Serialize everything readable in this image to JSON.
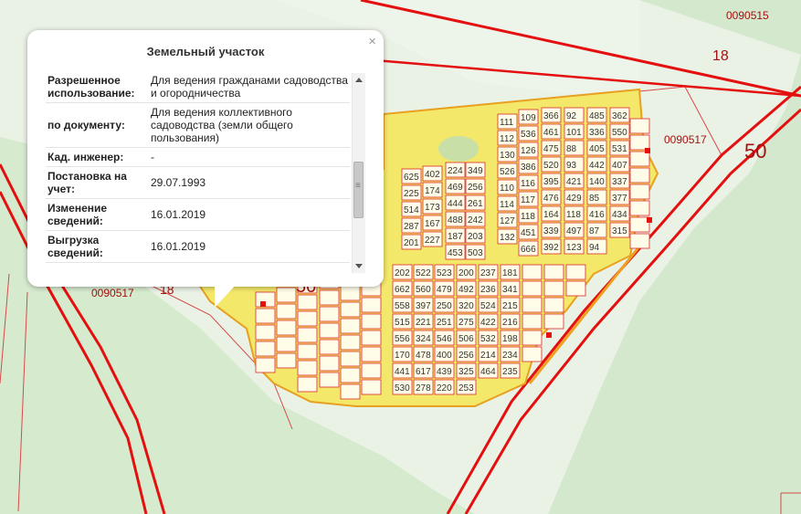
{
  "popup": {
    "title": "Земельный участок",
    "close_symbol": "×",
    "rows": [
      {
        "key": "Разрешенное использование:",
        "value": "Для ведения гражданами садоводства и огородничества"
      },
      {
        "key": "по документу:",
        "value": "Для ведения коллективного садоводства (земли общего пользования)"
      },
      {
        "key": "Кад. инженер:",
        "value": "-"
      },
      {
        "key": "Постановка на учет:",
        "value": "29.07.1993"
      },
      {
        "key": "Изменение сведений:",
        "value": "16.01.2019"
      },
      {
        "key": "Выгрузка сведений:",
        "value": "16.01.2019"
      }
    ]
  },
  "map": {
    "colors": {
      "background": "#e3efde",
      "forest": "#cfe6c7",
      "parcel_fill": "#f4e86a",
      "parcel_border": "#d92a2a",
      "boundary": "#e40f0f",
      "orange_line": "#f0a020"
    },
    "zone_labels": [
      {
        "text": "0090515"
      },
      {
        "text": "18"
      },
      {
        "text": "50"
      },
      {
        "text": "0090517"
      },
      {
        "text": "0090517"
      },
      {
        "text": "18"
      },
      {
        "text": "50"
      }
    ],
    "plot_numbers": [
      "111",
      "112",
      "130",
      "526",
      "110",
      "114",
      "127",
      "132",
      "109",
      "536",
      "126",
      "386",
      "116",
      "117",
      "118",
      "451",
      "666",
      "366",
      "461",
      "475",
      "520",
      "395",
      "476",
      "164",
      "339",
      "392",
      "92",
      "101",
      "88",
      "93",
      "421",
      "429",
      "118",
      "497",
      "123",
      "485",
      "336",
      "405",
      "442",
      "140",
      "85",
      "416",
      "87",
      "94",
      "362",
      "550",
      "531",
      "407",
      "337",
      "377",
      "434",
      "315",
      "625",
      "225",
      "514",
      "287",
      "201",
      "402",
      "174",
      "173",
      "167",
      "227",
      "224",
      "469",
      "444",
      "488",
      "187",
      "453",
      "349",
      "256",
      "261",
      "242",
      "203",
      "503",
      "202",
      "662",
      "558",
      "515",
      "556",
      "170",
      "441",
      "530",
      "522",
      "560",
      "397",
      "221",
      "324",
      "478",
      "617",
      "278",
      "523",
      "479",
      "250",
      "251",
      "546",
      "400",
      "439",
      "220",
      "200",
      "492",
      "320",
      "275",
      "506",
      "256",
      "325",
      "253",
      "237",
      "236",
      "524",
      "422",
      "532",
      "214",
      "464",
      "181",
      "341",
      "215",
      "216",
      "198",
      "234",
      "235"
    ]
  }
}
